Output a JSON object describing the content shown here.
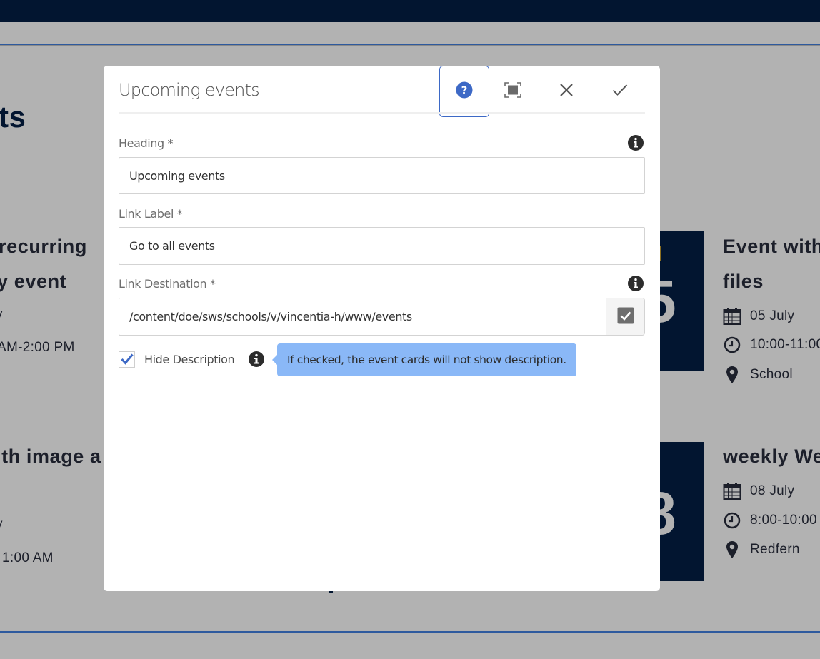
{
  "background": {
    "page_title_fragment": "ts",
    "left_events": [
      {
        "title_line1": "recurring",
        "title_line2": "y event",
        "date_fragment": "y",
        "time_fragment": "AM-2:00 PM"
      },
      {
        "title_line1": "ith image a",
        "date_fragment": "y",
        "time_fragment": "1:00 AM"
      }
    ],
    "right_events": [
      {
        "date_number_fragment": "5",
        "title_line1": "Event with",
        "title_line2": "files",
        "date": "05 July",
        "time": "10:00-11:00",
        "location": "School"
      },
      {
        "date_number_fragment": "8",
        "title_line1": "weekly We",
        "date": "08 July",
        "time": "8:00-10:00",
        "location": "Redfern"
      }
    ]
  },
  "dialog": {
    "title": "Upcoming events",
    "toolbar": {
      "help_icon": "help-circle-icon",
      "fullscreen_icon": "fullscreen-icon",
      "close_icon": "close-icon",
      "done_icon": "checkmark-icon"
    },
    "fields": {
      "heading": {
        "label": "Heading *",
        "value": "Upcoming events"
      },
      "link_label": {
        "label": "Link Label *",
        "value": "Go to all events"
      },
      "link_destination": {
        "label": "Link Destination *",
        "value": "/content/doe/sws/schools/v/vincentia-h/www/events"
      }
    },
    "hide_description": {
      "label": "Hide Description",
      "checked": true
    },
    "tooltip": "If checked, the event cards will not show description."
  },
  "colors": {
    "navy": "#021530",
    "accent_blue": "#3d69c6",
    "tooltip_bg": "#8ab8f7",
    "overlay_gray": "#b2b2b2"
  }
}
